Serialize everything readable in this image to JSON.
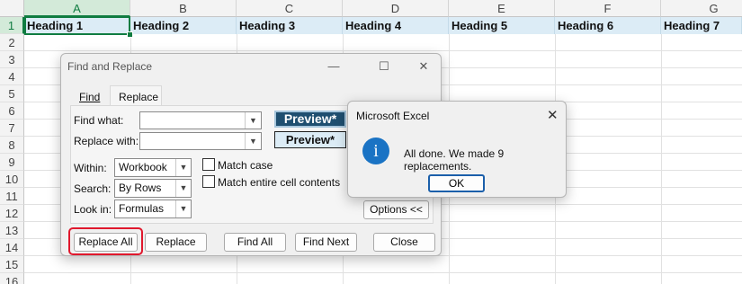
{
  "sheet": {
    "columns": [
      "A",
      "B",
      "C",
      "D",
      "E",
      "F",
      "G"
    ],
    "rows": [
      "1",
      "2",
      "3",
      "4",
      "5",
      "6",
      "7",
      "8",
      "9",
      "10",
      "11",
      "12",
      "13",
      "14",
      "15",
      "16"
    ],
    "headings": [
      "Heading 1",
      "Heading 2",
      "Heading 3",
      "Heading 4",
      "Heading 5",
      "Heading 6",
      "Heading 7"
    ]
  },
  "find_replace": {
    "title": "Find and Replace",
    "tabs": [
      "Find",
      "Replace"
    ],
    "find_what_label": "Find what:",
    "replace_with_label": "Replace with:",
    "preview_find": "Preview*",
    "preview_replace": "Preview*",
    "within_label": "Within:",
    "within_value": "Workbook",
    "search_label": "Search:",
    "search_value": "By Rows",
    "lookin_label": "Look in:",
    "lookin_value": "Formulas",
    "match_case_label": "Match case",
    "match_entire_label": "Match entire cell contents",
    "options_label": "Options <<",
    "buttons": {
      "replace_all": "Replace All",
      "replace": "Replace",
      "find_all": "Find All",
      "find_next": "Find Next",
      "close": "Close"
    },
    "window_controls": {
      "minimize": "—",
      "maximize": "☐",
      "close": "✕"
    }
  },
  "message_box": {
    "title": "Microsoft Excel",
    "close": "✕",
    "icon_glyph": "i",
    "message": "All done. We made 9 replacements.",
    "ok_label": "OK"
  },
  "colors": {
    "accent_green": "#107c41",
    "heading_fill": "#dcecf6",
    "highlight_red": "#e0182d",
    "info_blue": "#1a73c4"
  }
}
